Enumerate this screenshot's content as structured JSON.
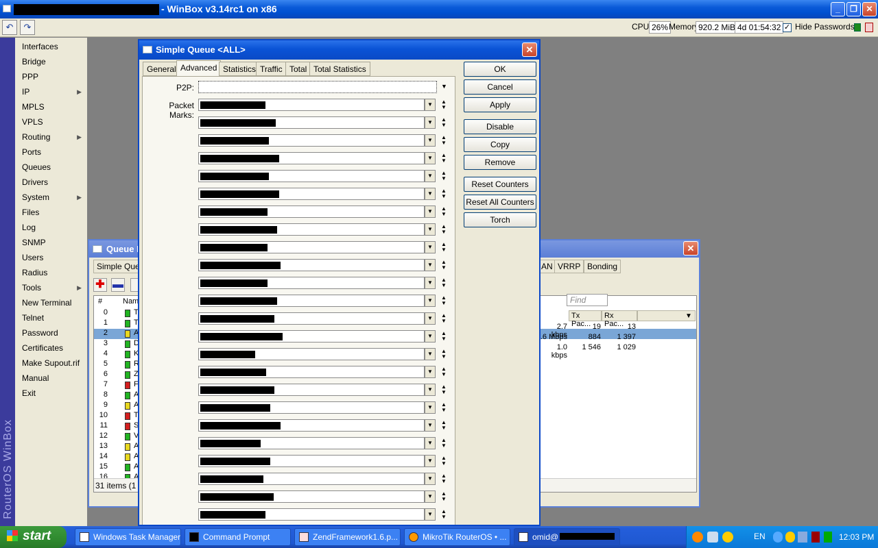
{
  "app": {
    "title": "- WinBox v3.14rc1 on x86",
    "cpu_label": "CPU:",
    "cpu_value": "26%",
    "memory_label": "Memory:",
    "memory_value": "920.2 MiB",
    "uptime": "4d 01:54:32",
    "hide_passwords_label": "Hide Passwords",
    "hide_passwords_checked": "✓",
    "brand": "RouterOS WinBox"
  },
  "menu": {
    "items": [
      {
        "label": "Interfaces",
        "arrow": ""
      },
      {
        "label": "Bridge",
        "arrow": ""
      },
      {
        "label": "PPP",
        "arrow": ""
      },
      {
        "label": "IP",
        "arrow": "▶"
      },
      {
        "label": "MPLS",
        "arrow": ""
      },
      {
        "label": "VPLS",
        "arrow": ""
      },
      {
        "label": "Routing",
        "arrow": "▶"
      },
      {
        "label": "Ports",
        "arrow": ""
      },
      {
        "label": "Queues",
        "arrow": ""
      },
      {
        "label": "Drivers",
        "arrow": ""
      },
      {
        "label": "System",
        "arrow": "▶"
      },
      {
        "label": "Files",
        "arrow": ""
      },
      {
        "label": "Log",
        "arrow": ""
      },
      {
        "label": "SNMP",
        "arrow": ""
      },
      {
        "label": "Users",
        "arrow": ""
      },
      {
        "label": "Radius",
        "arrow": ""
      },
      {
        "label": "Tools",
        "arrow": "▶"
      },
      {
        "label": "New Terminal",
        "arrow": ""
      },
      {
        "label": "Telnet",
        "arrow": ""
      },
      {
        "label": "Password",
        "arrow": ""
      },
      {
        "label": "Certificates",
        "arrow": ""
      },
      {
        "label": "Make Supout.rif",
        "arrow": ""
      },
      {
        "label": "Manual",
        "arrow": ""
      },
      {
        "label": "Exit",
        "arrow": ""
      }
    ]
  },
  "queue_list": {
    "title": "Queue L",
    "tab_simple": "Simple Queue",
    "tabs_right": [
      "AN",
      "VRRP",
      "Bonding"
    ],
    "find_placeholder": "Find",
    "col_hash": "#",
    "col_name": "Name",
    "col_tx_packets": "Tx Pac...",
    "col_rx_packets": "Rx Pac...",
    "rows": [
      {
        "num": "0",
        "name": "Te",
        "color": "#22b422",
        "rate": "2.7 kbps",
        "tx": "19",
        "rx": "13"
      },
      {
        "num": "1",
        "name": "Te",
        "color": "#22b422",
        "rate": ".6 Mbps",
        "tx": "884",
        "rx": "1 397"
      },
      {
        "num": "2",
        "name": "A",
        "color": "#e8d820",
        "rate": "1.0 kbps",
        "tx": "1 546",
        "rx": "1 029"
      },
      {
        "num": "3",
        "name": "D",
        "color": "#22b422",
        "rate": "",
        "tx": "",
        "rx": ""
      },
      {
        "num": "4",
        "name": "K",
        "color": "#22b422",
        "rate": "",
        "tx": "",
        "rx": ""
      },
      {
        "num": "5",
        "name": "R",
        "color": "#22b422",
        "rate": "",
        "tx": "",
        "rx": ""
      },
      {
        "num": "6",
        "name": "Z",
        "color": "#22b422",
        "rate": "",
        "tx": "",
        "rx": ""
      },
      {
        "num": "7",
        "name": "Fa",
        "color": "#d42020",
        "rate": "",
        "tx": "",
        "rx": ""
      },
      {
        "num": "8",
        "name": "A",
        "color": "#22b422",
        "rate": "",
        "tx": "",
        "rx": ""
      },
      {
        "num": "9",
        "name": "A",
        "color": "#e8d820",
        "rate": "",
        "tx": "",
        "rx": ""
      },
      {
        "num": "10",
        "name": "To",
        "color": "#d42020",
        "rate": "",
        "tx": "",
        "rx": ""
      },
      {
        "num": "11",
        "name": "Sa",
        "color": "#d42020",
        "rate": "",
        "tx": "",
        "rx": ""
      },
      {
        "num": "12",
        "name": "Vi",
        "color": "#22b422",
        "rate": "",
        "tx": "",
        "rx": ""
      },
      {
        "num": "13",
        "name": "A",
        "color": "#e8d820",
        "rate": "",
        "tx": "",
        "rx": ""
      },
      {
        "num": "14",
        "name": "A",
        "color": "#e8d820",
        "rate": "",
        "tx": "",
        "rx": ""
      },
      {
        "num": "15",
        "name": "A",
        "color": "#22b422",
        "rate": "",
        "tx": "",
        "rx": ""
      },
      {
        "num": "16",
        "name": "A",
        "color": "#22b422",
        "rate": "",
        "tx": "",
        "rx": ""
      },
      {
        "num": "17",
        "name": "A",
        "color": "#22b422",
        "rate": "",
        "tx": "",
        "rx": ""
      }
    ],
    "status": "31 items (1 se"
  },
  "dialog": {
    "title": "Simple Queue <ALL>",
    "tabs": [
      "General",
      "Advanced",
      "Statistics",
      "Traffic",
      "Total",
      "Total Statistics"
    ],
    "active_tab": "Advanced",
    "p2p_label": "P2P:",
    "packet_marks_label": "Packet Marks:",
    "buttons": [
      "OK",
      "Cancel",
      "Apply",
      "Disable",
      "Copy",
      "Remove",
      "Reset Counters",
      "Reset All Counters",
      "Torch"
    ]
  },
  "taskbar": {
    "start": "start",
    "tasks": [
      "Windows Task Manager",
      "Command Prompt",
      "ZendFramework1.6.p...",
      "MikroTik RouterOS • ...",
      "omid@"
    ],
    "lang": "EN",
    "clock": "12:03 PM"
  }
}
